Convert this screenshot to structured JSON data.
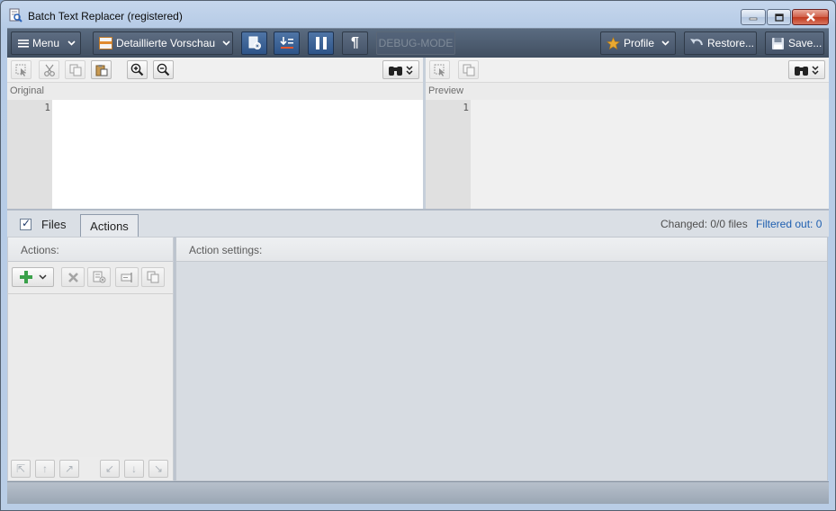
{
  "window": {
    "title": "Batch Text Replacer (registered)",
    "icon": "notepad-search-icon"
  },
  "window_controls": {
    "minimize": "minimize-icon",
    "maximize": "maximize-icon",
    "close": "close-icon"
  },
  "toolbar": {
    "menu_label": "Menu",
    "view_label": "Detaillierte Vorschau",
    "debug_label": "DEBUG-MODE",
    "profile_label": "Profile",
    "restore_label": "Restore...",
    "save_label": "Save..."
  },
  "original_pane": {
    "label": "Original",
    "line_number": "1"
  },
  "preview_pane": {
    "label": "Preview",
    "line_number": "1"
  },
  "tabs": {
    "files_label": "Files",
    "files_checked": true,
    "actions_label": "Actions"
  },
  "status": {
    "changed": "Changed: 0/0 files",
    "filtered": "Filtered out: 0"
  },
  "actions_panel": {
    "header": "Actions:"
  },
  "settings_panel": {
    "header": "Action settings:"
  },
  "colors": {
    "toolbar_bg": "#4a596d",
    "accent_blue": "#1e5fb0",
    "add_green": "#3aa14a",
    "window_bg": "#b9cde6"
  }
}
